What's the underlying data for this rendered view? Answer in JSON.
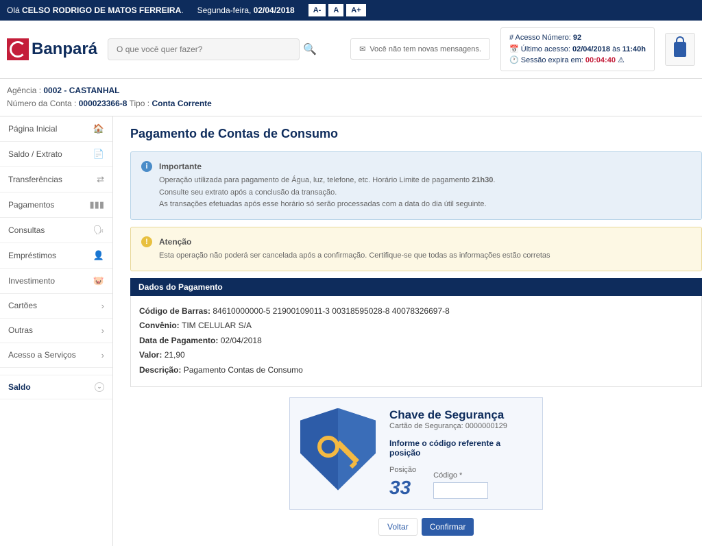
{
  "topbar": {
    "greeting_prefix": "Olá ",
    "username": "CELSO RODRIGO DE MATOS FERREIRA",
    "period": ".",
    "day_label": "Segunda-feira, ",
    "date": "02/04/2018",
    "font_minus": "A-",
    "font_normal": "A",
    "font_plus": "A+"
  },
  "logo": {
    "text": "Banpará"
  },
  "search": {
    "placeholder": "O que você quer fazer?"
  },
  "messages": {
    "text": "Você não tem novas mensagens."
  },
  "access": {
    "number_label": "# Acesso Número: ",
    "number": "92",
    "last_label": "Último acesso: ",
    "last_date": "02/04/2018",
    "last_sep": " às ",
    "last_time": "11:40h",
    "expires_label": "Sessão expira em: ",
    "expires_time": "00:04:40"
  },
  "account": {
    "agency_label": "Agência : ",
    "agency": "0002 - CASTANHAL",
    "acc_label": "Número da Conta : ",
    "acc": "000023366-8",
    "type_label": " Tipo : ",
    "type": "Conta Corrente"
  },
  "sidebar": {
    "items": [
      {
        "label": "Página Inicial",
        "icon": "🏠"
      },
      {
        "label": "Saldo / Extrato",
        "icon": "📄"
      },
      {
        "label": "Transferências",
        "icon": "⇄"
      },
      {
        "label": "Pagamentos",
        "icon": "▮▮▮"
      },
      {
        "label": "Consultas",
        "icon": "🗣"
      },
      {
        "label": "Empréstimos",
        "icon": "👤"
      },
      {
        "label": "Investimento",
        "icon": "🐷"
      },
      {
        "label": "Cartões",
        "icon": "›"
      },
      {
        "label": "Outras",
        "icon": "›"
      },
      {
        "label": "Acesso a Serviços",
        "icon": "›"
      }
    ],
    "saldo": "Saldo"
  },
  "page": {
    "title": "Pagamento de Contas de Consumo"
  },
  "alert_info": {
    "title": "Importante",
    "line1a": "Operação utilizada para pagamento de Água, luz, telefone, etc. Horário Limite de pagamento ",
    "line1b": "21h30",
    "line1c": ".",
    "line2": "Consulte seu extrato após a conclusão da transação.",
    "line3": "As transações efetuadas após esse horário só serão processadas com a data do dia útil seguinte."
  },
  "alert_warning": {
    "title": "Atenção",
    "body": "Esta operação não poderá ser cancelada após a confirmação. Certifique-se que todas as informações estão corretas"
  },
  "section": {
    "title": "Dados do Pagamento"
  },
  "payment": {
    "barcode_label": "Código de Barras: ",
    "barcode": "84610000000-5 21900109011-3 00318595028-8 40078326697-8",
    "conv_label": "Convênio: ",
    "conv": "TIM CELULAR S/A",
    "date_label": "Data de Pagamento: ",
    "date": "02/04/2018",
    "value_label": "Valor: ",
    "value": "21,90",
    "desc_label": "Descrição: ",
    "desc": "Pagamento Contas de Consumo"
  },
  "security": {
    "title": "Chave de Segurança",
    "sub_label": "Cartão de Segurança: ",
    "card_number": "0000000129",
    "instruction": "Informe o código referente a posição",
    "position_label": "Posição",
    "position": "33",
    "code_label": "Código *"
  },
  "buttons": {
    "back": "Voltar",
    "confirm": "Confirmar"
  }
}
